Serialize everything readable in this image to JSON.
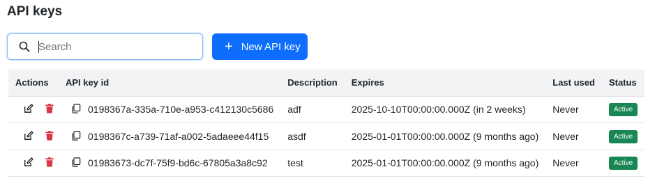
{
  "page": {
    "title": "API keys"
  },
  "search": {
    "placeholder": "Search",
    "value": ""
  },
  "toolbar": {
    "new_key_label": "New API key"
  },
  "table": {
    "headers": {
      "actions": "Actions",
      "key_id": "API key id",
      "description": "Description",
      "expires": "Expires",
      "last_used": "Last used",
      "status": "Status"
    },
    "rows": [
      {
        "key_id": "0198367a-335a-710e-a953-c412130c5686",
        "description": "adf",
        "expires": "2025-10-10T00:00:00.000Z (in 2 weeks)",
        "last_used": "Never",
        "status": "Active"
      },
      {
        "key_id": "0198367c-a739-71af-a002-5adaeee44f15",
        "description": "asdf",
        "expires": "2025-01-01T00:00:00.000Z (9 months ago)",
        "last_used": "Never",
        "status": "Active"
      },
      {
        "key_id": "01983673-dc7f-75f9-bd6c-67805a3a8c92",
        "description": "test",
        "expires": "2025-01-01T00:00:00.000Z (9 months ago)",
        "last_used": "Never",
        "status": "Active"
      }
    ]
  },
  "icons": {
    "search": "search-icon",
    "plus": "plus-icon",
    "edit": "edit-icon",
    "delete": "trash-icon",
    "copy": "copy-icon"
  },
  "colors": {
    "primary": "#0d6efd",
    "danger": "#dc3545",
    "success": "#198754",
    "header_bg": "#f1f3f5"
  }
}
